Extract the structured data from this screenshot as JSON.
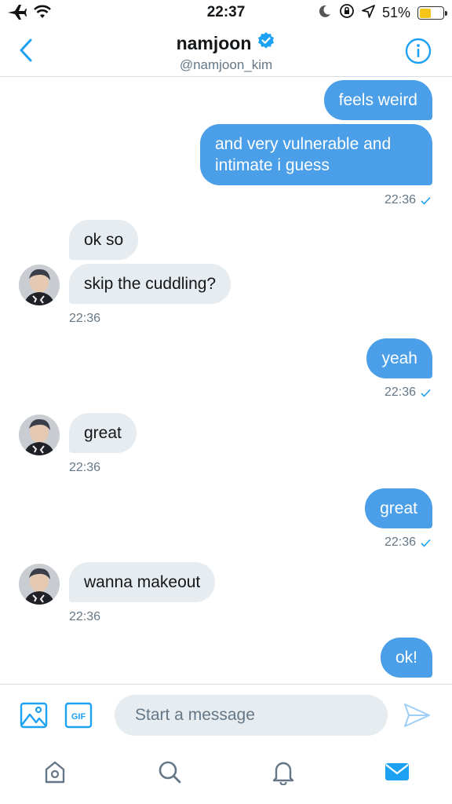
{
  "status_bar": {
    "time": "22:37",
    "battery_text": "51%",
    "battery_level": 0.51,
    "icons": [
      "airplane-icon",
      "wifi-icon",
      "moon-icon",
      "orientation-lock-icon",
      "location-icon",
      "battery-icon"
    ]
  },
  "header": {
    "name": "namjoon",
    "handle": "@namjoon_kim",
    "verified": true,
    "accent_color": "#1da1f2"
  },
  "messages": [
    {
      "side": "sent",
      "text": "feels weird"
    },
    {
      "side": "sent",
      "text": "and very vulnerable and intimate i guess"
    },
    {
      "side": "sent",
      "timestamp": "22:36",
      "read": true
    },
    {
      "side": "received",
      "text": "ok so"
    },
    {
      "side": "received",
      "text": "skip the cuddling?"
    },
    {
      "side": "received",
      "timestamp": "22:36"
    },
    {
      "side": "sent",
      "text": "yeah"
    },
    {
      "side": "sent",
      "timestamp": "22:36",
      "read": true
    },
    {
      "side": "received",
      "text": "great"
    },
    {
      "side": "received",
      "timestamp": "22:36"
    },
    {
      "side": "sent",
      "text": "great"
    },
    {
      "side": "sent",
      "timestamp": "22:36",
      "read": true
    },
    {
      "side": "received",
      "text": "wanna makeout"
    },
    {
      "side": "received",
      "timestamp": "22:36"
    },
    {
      "side": "sent",
      "text": "ok!"
    }
  ],
  "composer": {
    "placeholder": "Start a message",
    "gif_label": "GIF"
  },
  "tabs": [
    "home-icon",
    "search-icon",
    "notifications-icon",
    "messages-icon"
  ],
  "colors": {
    "sent_bubble": "#4a9fe8",
    "received_bubble": "#e6ecf0",
    "active_tab": "#1da1f2"
  }
}
